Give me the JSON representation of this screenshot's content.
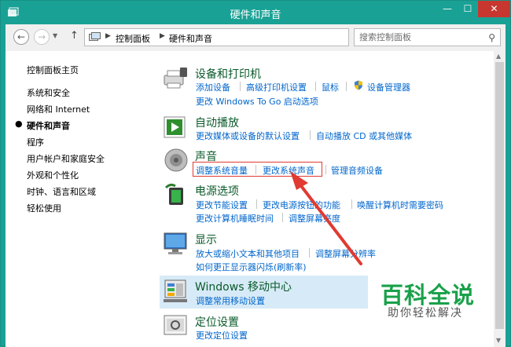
{
  "window": {
    "title": "硬件和声音",
    "min_glyph": "—",
    "max_glyph": "☐",
    "close_glyph": "✕"
  },
  "address": {
    "crumbs": [
      "控制面板",
      "硬件和声音"
    ],
    "search_placeholder": "搜索控制面板"
  },
  "sidebar": {
    "items": [
      {
        "label": "控制面板主页",
        "current": false
      },
      {
        "label": "系统和安全",
        "current": false
      },
      {
        "label": "网络和 Internet",
        "current": false
      },
      {
        "label": "硬件和声音",
        "current": true
      },
      {
        "label": "程序",
        "current": false
      },
      {
        "label": "用户帐户和家庭安全",
        "current": false
      },
      {
        "label": "外观和个性化",
        "current": false
      },
      {
        "label": "时钟、语言和区域",
        "current": false
      },
      {
        "label": "轻松使用",
        "current": false
      }
    ]
  },
  "categories": [
    {
      "title": "设备和打印机",
      "icon": "printer-icon",
      "links": [
        [
          "添加设备",
          "高级打印机设置",
          "鼠标",
          "设备管理器"
        ],
        [
          "更改 Windows To Go 启动选项"
        ]
      ]
    },
    {
      "title": "自动播放",
      "icon": "autoplay-icon",
      "links": [
        [
          "更改媒体或设备的默认设置",
          "自动播放 CD 或其他媒体"
        ]
      ]
    },
    {
      "title": "声音",
      "icon": "speaker-icon",
      "links": [
        [
          "调整系统音量",
          "更改系统声音",
          "管理音频设备"
        ]
      ]
    },
    {
      "title": "电源选项",
      "icon": "power-icon",
      "links": [
        [
          "更改节能设置",
          "更改电源按钮的功能",
          "唤醒计算机时需要密码"
        ],
        [
          "更改计算机睡眠时间",
          "调整屏幕亮度"
        ]
      ]
    },
    {
      "title": "显示",
      "icon": "display-icon",
      "links": [
        [
          "放大或缩小文本和其他项目",
          "调整屏幕分辨率"
        ],
        [
          "如何更正显示器闪烁(刷新率)"
        ]
      ]
    },
    {
      "title": "Windows 移动中心",
      "icon": "mobility-center-icon",
      "links": [
        [
          "调整常用移动设置"
        ]
      ]
    },
    {
      "title": "定位设置",
      "icon": "location-icon",
      "links": [
        [
          "更改定位设置"
        ]
      ]
    }
  ],
  "watermark": {
    "title": "百科全说",
    "subtitle": "助你轻松解决"
  },
  "colors": {
    "titlebar": "#1aa195",
    "close": "#c7372f",
    "link": "#0066cc",
    "category_title": "#0a5a2a",
    "highlight": "#e03a32",
    "watermark": "#1aa14a"
  }
}
